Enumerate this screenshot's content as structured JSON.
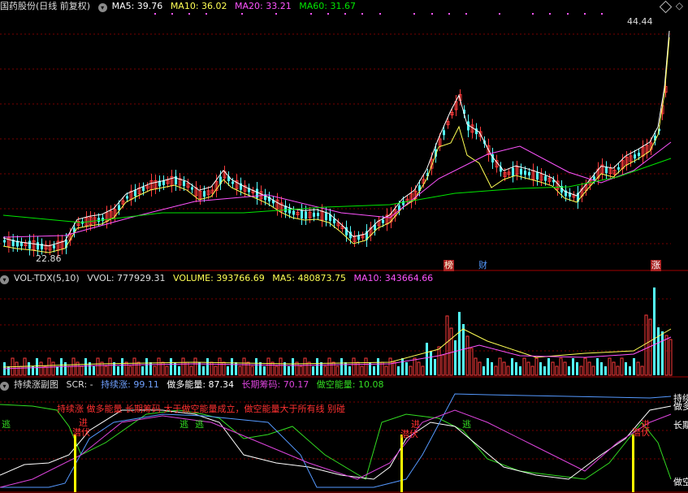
{
  "price_panel": {
    "stock_name": "国药股份",
    "period": "(日线 前复权)",
    "ma5": "MA5: 39.76",
    "ma10": "MA10: 36.02",
    "ma20": "MA20: 33.21",
    "ma60": "MA60: 31.67",
    "high_label": "44.44",
    "low_label": "22.86",
    "event_tags": [
      "榜",
      "财",
      "涨"
    ]
  },
  "volume_panel": {
    "indicator": "VOL-TDX(5,10)",
    "vvol": "VVOL: 777929.31",
    "volume": "VOLUME: 393766.69",
    "ma5": "MA5: 480873.75",
    "ma10": "MA10: 343664.66"
  },
  "sub_panel": {
    "indicator": "持续涨副图",
    "scr": "SCR: -",
    "rise": "持续涨: 99.11",
    "long_energy": "做多能量: 87.34",
    "chips": "长期筹码: 70.17",
    "short_energy": "做空能量: 10.08",
    "banner": "持续涨 做多能量 长期筹码 大于做空能量成立，做空能量大于所有线 别碰",
    "signals": [
      "逃",
      "进",
      "潜伏",
      "逃",
      "逃",
      "进",
      "潜伏",
      "逃",
      "进",
      "潜伏"
    ],
    "right_labels": [
      "持续",
      "做多",
      "长期",
      "做空"
    ]
  },
  "colors": {
    "up": "#ff3b3b",
    "down": "#54ffff",
    "ma5": "#ffffff",
    "ma10": "#ffff54",
    "ma20": "#ff54ff",
    "ma60": "#00e600",
    "grid": "#7a0000",
    "signal_bar": "#ffff00",
    "white_line": "#ffffff",
    "green_line": "#33dd22",
    "blue_line": "#5599ff",
    "magenta_line": "#dd44dd"
  }
}
